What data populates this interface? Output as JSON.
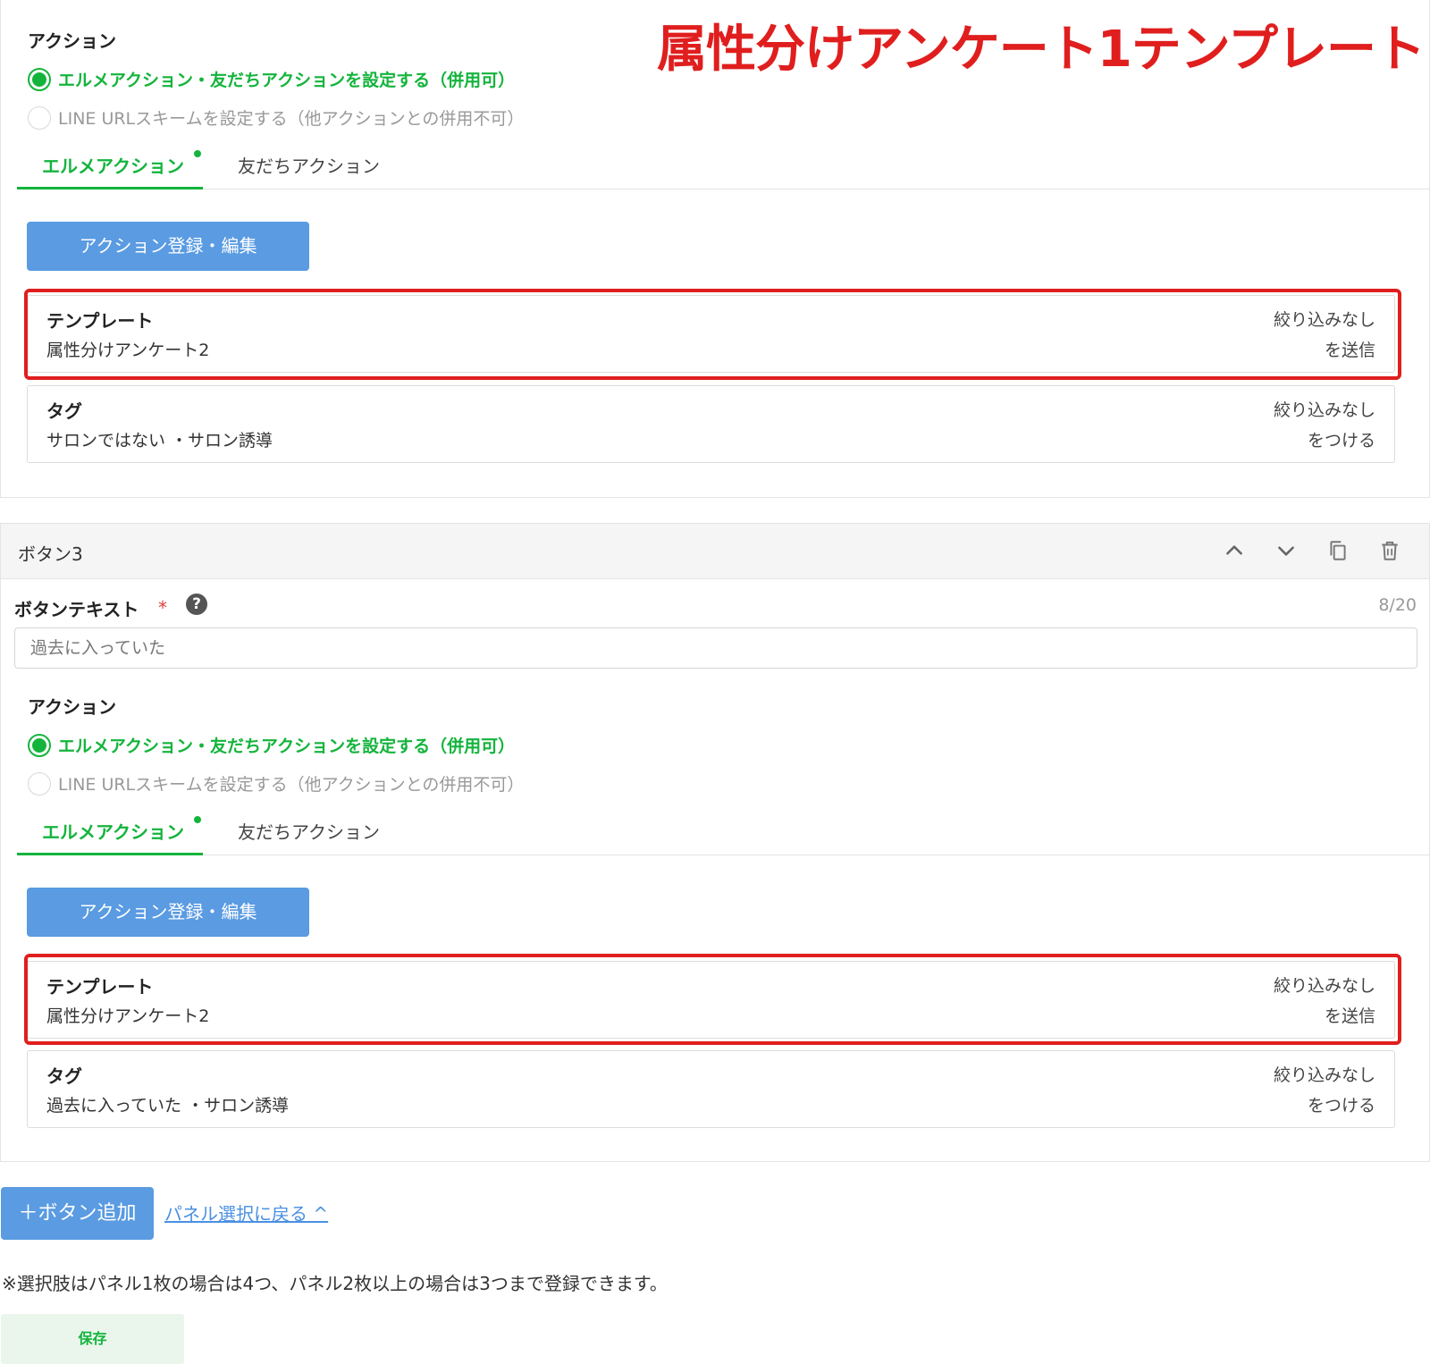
{
  "overlay": {
    "title": "属性分けアンケート1テンプレート"
  },
  "colors": {
    "accent_green": "#14b43c",
    "button_blue": "#5a9be2",
    "highlight_red": "#e01e1e",
    "link_blue": "#4a90e2"
  },
  "panel_top": {
    "action_label": "アクション",
    "radio_selected": "エルメアクション・友だちアクションを設定する（併用可）",
    "radio_unselected": "LINE URLスキームを設定する（他アクションとの併用不可）",
    "tab_active": "エルメアクション",
    "tab_inactive": "友だちアクション",
    "action_button": "アクション登録・編集",
    "template_card": {
      "title": "テンプレート",
      "value": "属性分けアンケート2",
      "filter": "絞り込みなし",
      "suffix": "を送信"
    },
    "tag_card": {
      "title": "タグ",
      "value": "サロンではない ・サロン誘導",
      "filter": "絞り込みなし",
      "suffix": "をつける"
    }
  },
  "panel_button3": {
    "header": "ボタン3",
    "icons": [
      "chevron-up-icon",
      "chevron-down-icon",
      "copy-icon",
      "trash-icon"
    ],
    "button_text_label": "ボタンテキスト",
    "required_mark": "*",
    "help_mark": "?",
    "counter": "8/20",
    "button_text_value": "過去に入っていた",
    "action_label": "アクション",
    "radio_selected": "エルメアクション・友だちアクションを設定する（併用可）",
    "radio_unselected": "LINE URLスキームを設定する（他アクションとの併用不可）",
    "tab_active": "エルメアクション",
    "tab_inactive": "友だちアクション",
    "action_button": "アクション登録・編集",
    "template_card": {
      "title": "テンプレート",
      "value": "属性分けアンケート2",
      "filter": "絞り込みなし",
      "suffix": "を送信"
    },
    "tag_card": {
      "title": "タグ",
      "value": "過去に入っていた ・サロン誘導",
      "filter": "絞り込みなし",
      "suffix": "をつける"
    }
  },
  "footer": {
    "add_button": "＋ボタン追加",
    "back_link": "パネル選択に戻る ^",
    "note": "※選択肢はパネル1枚の場合は4つ、パネル2枚以上の場合は3つまで登録できます。",
    "save_button": "保存"
  }
}
